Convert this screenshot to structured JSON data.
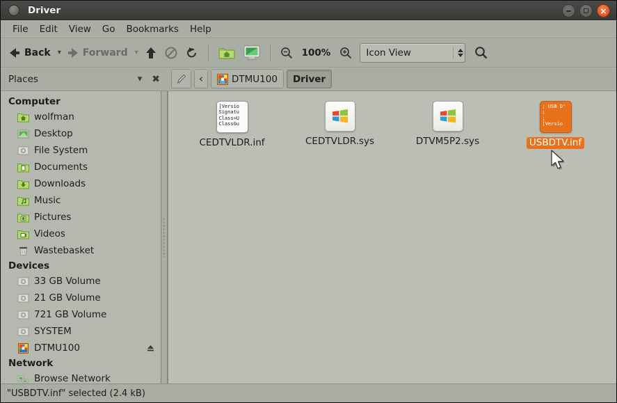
{
  "window": {
    "title": "Driver",
    "buttons": {
      "minimize": "minimize",
      "maximize": "maximize",
      "close": "close"
    }
  },
  "menubar": {
    "items": [
      "File",
      "Edit",
      "View",
      "Go",
      "Bookmarks",
      "Help"
    ]
  },
  "toolbar": {
    "back_label": "Back",
    "forward_label": "Forward",
    "up_label": "Up",
    "stop_label": "Stop",
    "reload_label": "Reload",
    "home_label": "Home",
    "computer_label": "Computer",
    "zoom_out_label": "Zoom Out",
    "zoom_level": "100%",
    "zoom_in_label": "Zoom In",
    "view_mode": "Icon View",
    "search_label": "Search"
  },
  "places": {
    "title": "Places",
    "menu_glyph": "⌄",
    "close_glyph": "✖"
  },
  "pathbar": {
    "edit_location_label": "Edit Location",
    "prev_glyph": "‹",
    "crumbs": [
      {
        "label": "DTMU100",
        "icon": "media-disc-icon",
        "active": false
      },
      {
        "label": "Driver",
        "icon": "",
        "active": true
      }
    ]
  },
  "sidebar": {
    "sections": [
      {
        "heading": "Computer",
        "items": [
          {
            "label": "wolfman",
            "icon": "home-folder-icon"
          },
          {
            "label": "Desktop",
            "icon": "desktop-folder-icon"
          },
          {
            "label": "File System",
            "icon": "drive-icon"
          },
          {
            "label": "Documents",
            "icon": "documents-folder-icon"
          },
          {
            "label": "Downloads",
            "icon": "downloads-folder-icon"
          },
          {
            "label": "Music",
            "icon": "music-folder-icon"
          },
          {
            "label": "Pictures",
            "icon": "pictures-folder-icon"
          },
          {
            "label": "Videos",
            "icon": "videos-folder-icon"
          },
          {
            "label": "Wastebasket",
            "icon": "wastebasket-icon"
          }
        ]
      },
      {
        "heading": "Devices",
        "items": [
          {
            "label": "33 GB Volume",
            "icon": "drive-icon"
          },
          {
            "label": "21 GB Volume",
            "icon": "drive-icon"
          },
          {
            "label": "721 GB Volume",
            "icon": "drive-icon"
          },
          {
            "label": "SYSTEM",
            "icon": "drive-icon"
          },
          {
            "label": "DTMU100",
            "icon": "media-disc-icon",
            "eject": "⏏"
          }
        ]
      },
      {
        "heading": "Network",
        "items": [
          {
            "label": "Browse Network",
            "icon": "network-icon"
          }
        ]
      }
    ]
  },
  "files": [
    {
      "name": "CEDTVLDR.inf",
      "icon": "inf-text-document-icon",
      "preview": "[Versio\nSignatu\nClass=U\nClassGu",
      "selected": false
    },
    {
      "name": "CEDTVLDR.sys",
      "icon": "windows-system-file-icon",
      "preview": "",
      "selected": false
    },
    {
      "name": "DTVM5P2.sys",
      "icon": "windows-system-file-icon",
      "preview": "",
      "selected": false
    },
    {
      "name": "USBDTV.inf",
      "icon": "inf-text-document-icon",
      "preview": "; USB D'\n;\n;\n[Versio",
      "selected": true
    }
  ],
  "statusbar": {
    "text": "\"USBDTV.inf\" selected (2.4 kB)"
  },
  "colors": {
    "selection": "#e8721c",
    "titlebar": "#3f3f3d",
    "chrome": "#a9ada3",
    "sidebar": "#b4b8ae",
    "fileview": "#babeb4"
  }
}
